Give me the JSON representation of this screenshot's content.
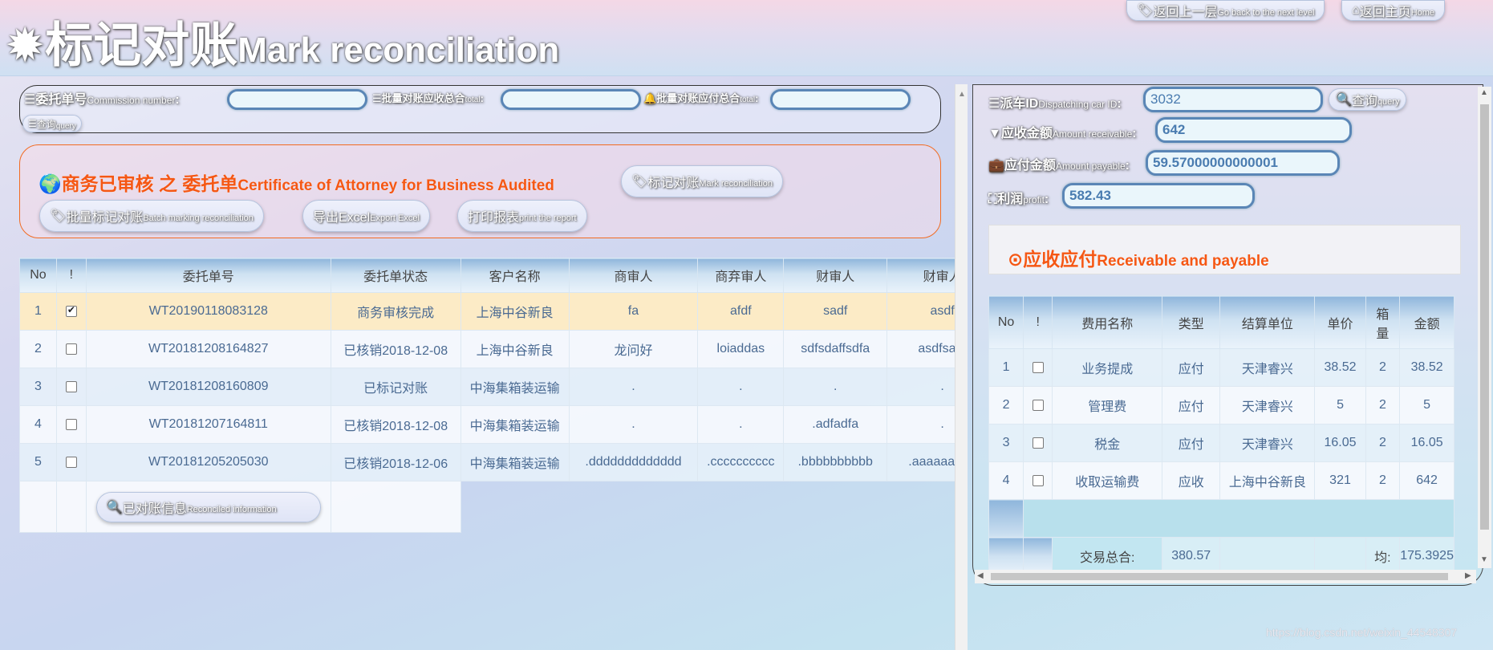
{
  "header": {
    "title_icon": "burst-icon",
    "title_cn": "标记对账",
    "title_en": "Mark reconciliation",
    "back_btn": {
      "cn": "返回上一层",
      "en": "Go back to the next level",
      "icon": "tag-icon"
    },
    "home_btn": {
      "cn": "返回主页",
      "en": "Home",
      "icon": "home-icon"
    }
  },
  "search": {
    "commission_label_cn": "委托单号",
    "commission_label_en": "Commission number",
    "commission_value": "",
    "receivable_total_cn": "批量对账应收总合",
    "receivable_total_en": "total",
    "receivable_total_value": "",
    "payable_total_cn": "批量对账应付总合",
    "payable_total_en": "total",
    "payable_total_value": "",
    "query_cn": "查询",
    "query_en": "query",
    "colon": ":"
  },
  "section": {
    "title_cn": "商务已审核 之 委托单",
    "title_en": "Certificate of Attorney for Business Audited",
    "mark_btn_cn": "标记对账",
    "mark_btn_en": "Mark reconciliation",
    "batch_btn_cn": "批量标记对账",
    "batch_btn_en": "Batch marking reconciliation",
    "excel_btn_cn": "导出Excel",
    "excel_btn_en": "Export Excel",
    "print_btn_cn": "打印报表",
    "print_btn_en": "print the report"
  },
  "orders": {
    "columns": [
      "No",
      "!",
      "委托单号",
      "委托单状态",
      "客户名称",
      "商审人",
      "商弃审人",
      "财审人",
      "财审人"
    ],
    "rows": [
      {
        "no": "1",
        "checked": true,
        "id": "WT20190118083128",
        "status": "商务审核完成",
        "customer": "上海中谷新良",
        "c1": "fa",
        "c2": "afdf",
        "c3": "sadf",
        "c4": "asdf"
      },
      {
        "no": "2",
        "checked": false,
        "id": "WT20181208164827",
        "status": "已核销2018-12-08",
        "customer": "上海中谷新良",
        "c1": "龙问好",
        "c2": "loiaddas",
        "c3": "sdfsdaffsdfa",
        "c4": "asdfsadf"
      },
      {
        "no": "3",
        "checked": false,
        "id": "WT20181208160809",
        "status": "已标记对账",
        "customer": "中海集箱装运输",
        "c1": ".",
        "c2": ".",
        "c3": ".",
        "c4": "."
      },
      {
        "no": "4",
        "checked": false,
        "id": "WT20181207164811",
        "status": "已核销2018-12-08",
        "customer": "中海集箱装运输",
        "c1": ".",
        "c2": ".",
        "c3": ".adfadfa",
        "c4": "."
      },
      {
        "no": "5",
        "checked": false,
        "id": "WT20181205205030",
        "status": "已核销2018-12-06",
        "customer": "中海集箱装运输",
        "c1": ".ddddddddddddd",
        "c2": ".cccccccccc",
        "c3": ".bbbbbbbbbb",
        "c4": ".aaaaaaaaa"
      }
    ],
    "reconciled_btn_cn": "已对账信息",
    "reconciled_btn_en": "Reconciled information"
  },
  "detail": {
    "car_label_cn": "派车ID",
    "car_label_en": "Dispatching car ID",
    "car_value": "3032",
    "query_cn": "查询",
    "query_en": "query",
    "receivable_cn": "应收金额",
    "receivable_en": "Amount receivable",
    "receivable_value": "642",
    "payable_cn": "应付金额",
    "payable_en": "Amount payable",
    "payable_value": "59.57000000000001",
    "profit_cn": "利润",
    "profit_en": "profit",
    "profit_value": "582.43",
    "section_cn": "应收应付",
    "section_en": "Receivable and payable",
    "colon": ":"
  },
  "fees": {
    "columns": [
      "No",
      "!",
      "费用名称",
      "类型",
      "结算单位",
      "单价",
      "箱量",
      "金额"
    ],
    "rows": [
      {
        "no": "1",
        "name": "业务提成",
        "type": "应付",
        "unit": "天津睿兴",
        "price": "38.52",
        "qty": "2",
        "amount": "38.52"
      },
      {
        "no": "2",
        "name": "管理费",
        "type": "应付",
        "unit": "天津睿兴",
        "price": "5",
        "qty": "2",
        "amount": "5"
      },
      {
        "no": "3",
        "name": "税金",
        "type": "应付",
        "unit": "天津睿兴",
        "price": "16.05",
        "qty": "2",
        "amount": "16.05"
      },
      {
        "no": "4",
        "name": "收取运输费",
        "type": "应收",
        "unit": "上海中谷新良",
        "price": "321",
        "qty": "2",
        "amount": "642"
      }
    ],
    "footer": {
      "total_label": "交易总合:",
      "total_value": "380.57",
      "avg_label": "均:",
      "avg_value": "175.3925"
    }
  },
  "watermark": "https://blog.csdn.net/weixin_44548307"
}
